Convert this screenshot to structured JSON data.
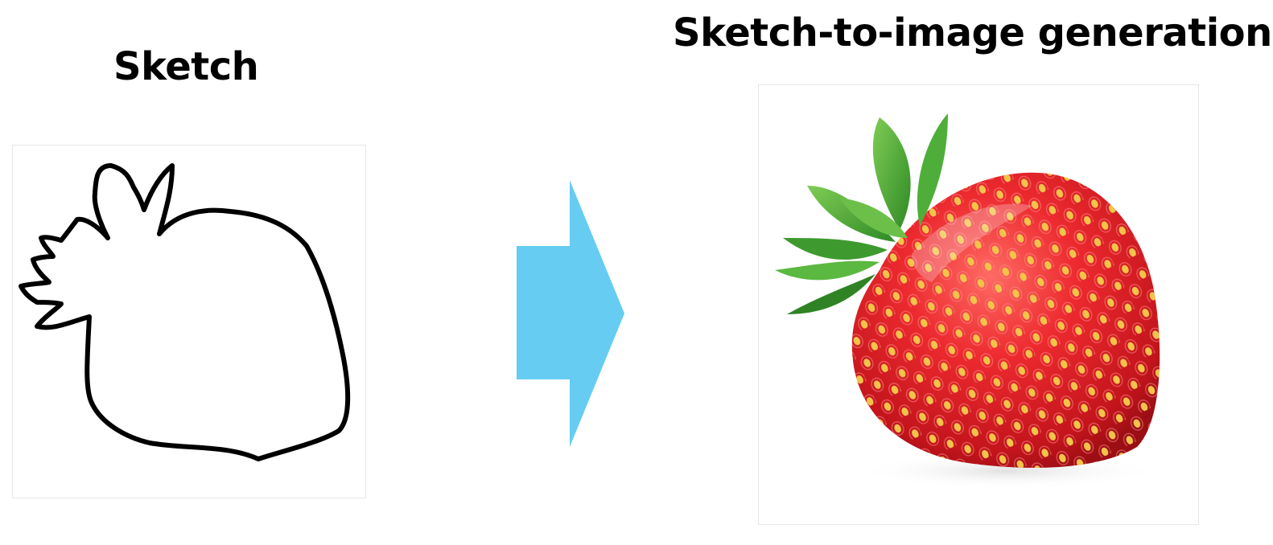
{
  "labels": {
    "left_title": "Sketch",
    "right_title": "Sketch-to-image generation"
  },
  "panels": {
    "left": {
      "content": "strawberry-sketch"
    },
    "right": {
      "content": "strawberry-photo"
    }
  },
  "colors": {
    "arrow": "#66ccf2",
    "sketch_stroke": "#000000",
    "strawberry_red": "#e8232a",
    "leaf_green": "#3e9a2f",
    "seed_yellow": "#f3c34a"
  }
}
